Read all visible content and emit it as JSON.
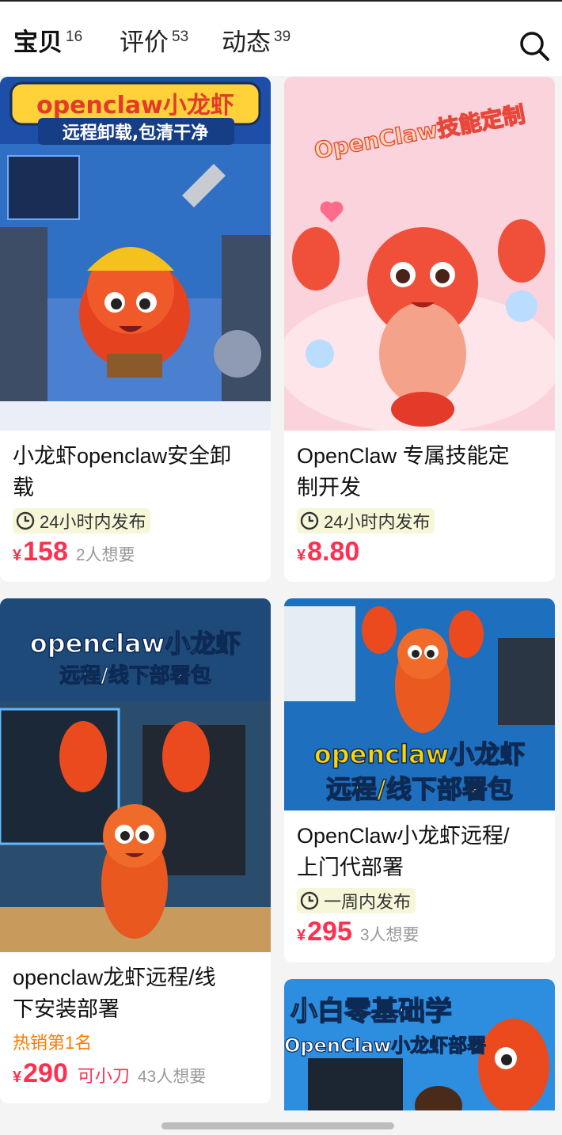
{
  "tabs": [
    {
      "label": "宝贝",
      "count": "16"
    },
    {
      "label": "评价",
      "count": "53"
    },
    {
      "label": "动态",
      "count": "39"
    }
  ],
  "products": [
    {
      "image_text": [
        "openclaw小龙虾",
        "远程卸载,包清干净"
      ],
      "title_line1": "小龙虾openclaw安全卸",
      "title_line2": "载",
      "tag": "24小时内发布",
      "currency": "¥",
      "price": "158",
      "wants": "2人想要"
    },
    {
      "image_text": [
        "OpenClaw技能定制"
      ],
      "title_line1": "OpenClaw 专属技能定",
      "title_line2": "制开发",
      "tag": "24小时内发布",
      "currency": "¥",
      "price": "8.80",
      "wants": ""
    },
    {
      "image_text": [
        "openclaw小龙虾",
        "远程/线下部署包"
      ],
      "title_line1": "openclaw龙虾远程/线",
      "title_line2": "下安装部署",
      "hot": "热销第1名",
      "currency": "¥",
      "price": "290",
      "bargain": "可小刀",
      "wants": "43人想要"
    },
    {
      "image_text": [
        "openclaw小龙虾",
        "远程/线下部署包"
      ],
      "title_line1": "OpenClaw小龙虾远程/",
      "title_line2": "上门代部署",
      "tag": "一周内发布",
      "currency": "¥",
      "price": "295",
      "wants": "3人想要"
    },
    {
      "image_text": [
        "小白零基础学",
        "OpenClaw小龙虾部署"
      ]
    }
  ],
  "colors": {
    "accent_yellow": "#ffe400",
    "price_red": "#ff2f50",
    "hot_orange": "#ff7a00"
  }
}
